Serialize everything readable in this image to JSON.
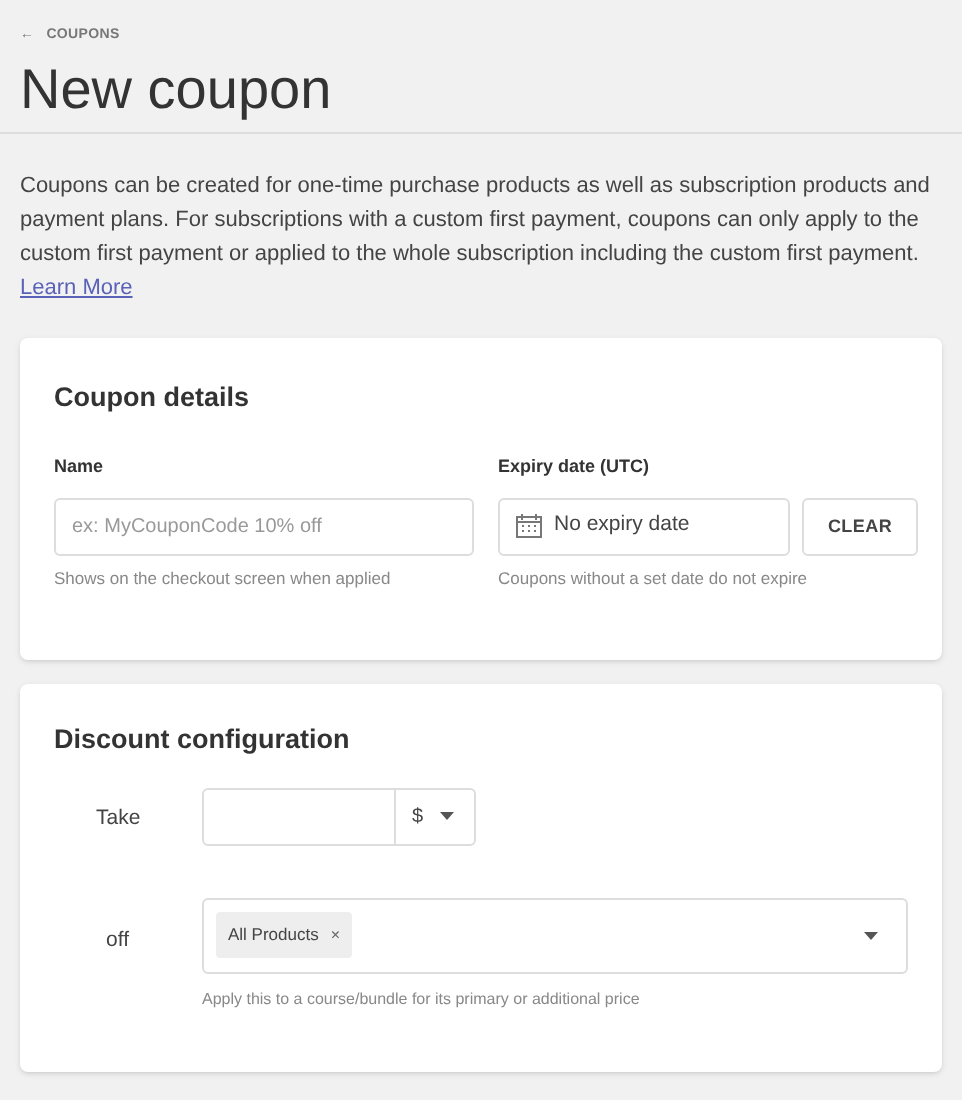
{
  "breadcrumb": {
    "arrow": "←",
    "label": "COUPONS"
  },
  "title": "New coupon",
  "intro": {
    "text": "Coupons can be created for one-time purchase products as well as subscription products and payment plans. For subscriptions with a custom first payment, coupons can only apply to the custom first payment or applied to the whole subscription including the custom first payment.",
    "link": "Learn More"
  },
  "coupon_details": {
    "heading": "Coupon details",
    "name": {
      "label": "Name",
      "placeholder": "ex: MyCouponCode 10% off",
      "hint": "Shows on the checkout screen when applied"
    },
    "expiry": {
      "label": "Expiry date (UTC)",
      "value": "No expiry date",
      "button": "CLEAR",
      "hint": "Coupons without a set date do not expire"
    }
  },
  "discount_configuration": {
    "heading": "Discount configuration",
    "take": {
      "label": "Take",
      "unit": "$"
    },
    "off": {
      "label": "off",
      "tags": [
        {
          "label": "All Products",
          "remove": "×"
        }
      ],
      "hint": "Apply this to a course/bundle for its primary or additional price"
    }
  }
}
